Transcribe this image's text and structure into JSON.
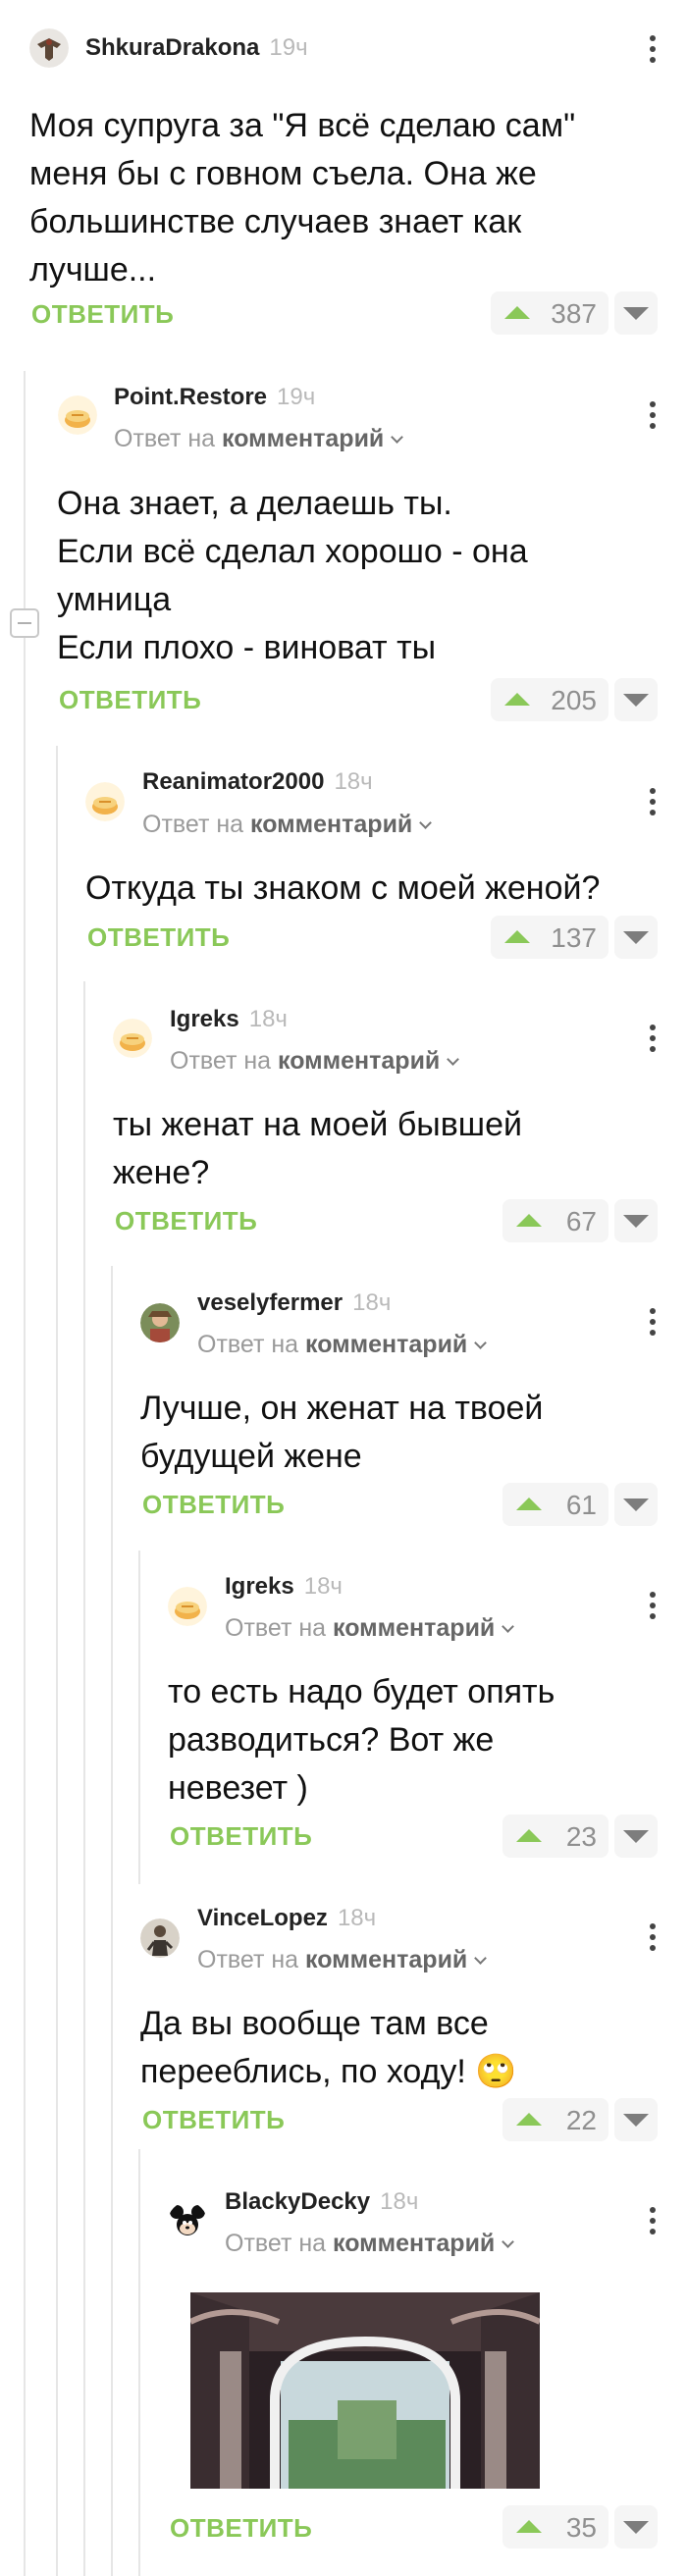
{
  "labels": {
    "reply": "ОТВЕТИТЬ",
    "reply_to_prefix": "Ответ на",
    "reply_to_target": "комментарий"
  },
  "comments": [
    {
      "user": "ShkuraDrakona",
      "time": "19ч",
      "reply_to": false,
      "lines": [
        "Моя супруга за \"Я всё сделаю сам\"",
        "меня бы с говном съела. Она же",
        "большинстве случаев знает как",
        "лучше..."
      ],
      "rating": "387",
      "avatar": "eagle-avatar"
    },
    {
      "user": "Point.Restore",
      "time": "19ч",
      "reply_to": true,
      "lines": [
        "Она знает, а делаешь ты.",
        "Если всё сделал хорошо - она",
        "умница",
        "Если плохо - виноват ты"
      ],
      "rating": "205",
      "avatar": "pie-avatar"
    },
    {
      "user": "Reanimator2000",
      "time": "18ч",
      "reply_to": true,
      "lines": [
        "Откуда ты знаком с моей женой?"
      ],
      "rating": "137",
      "avatar": "pie-avatar"
    },
    {
      "user": "Igreks",
      "time": "18ч",
      "reply_to": true,
      "lines": [
        "ты женат на моей бывшей",
        "жене?"
      ],
      "rating": "67",
      "avatar": "pie-avatar"
    },
    {
      "user": "veselyfermer",
      "time": "18ч",
      "reply_to": true,
      "lines": [
        "Лучше, он женат на твоей",
        "будущей жене"
      ],
      "rating": "61",
      "avatar": "farmer-avatar"
    },
    {
      "user": "Igreks",
      "time": "18ч",
      "reply_to": true,
      "lines": [
        "то есть надо будет опять",
        "разводиться? Вот же",
        "невезет )"
      ],
      "rating": "23",
      "avatar": "pie-avatar"
    },
    {
      "user": "VinceLopez",
      "time": "18ч",
      "reply_to": true,
      "lines": [
        "Да вы вообще там все",
        "перееблись, по ходу! 🙄"
      ],
      "rating": "22",
      "avatar": "person-avatar"
    },
    {
      "user": "BlackyDecky",
      "time": "18ч",
      "reply_to": true,
      "lines": [],
      "rating": "35",
      "avatar": "mouse-avatar"
    }
  ],
  "colors": {
    "accent": "#8ac858",
    "muted": "#9a9a9a",
    "line": "#e6e6e6"
  }
}
